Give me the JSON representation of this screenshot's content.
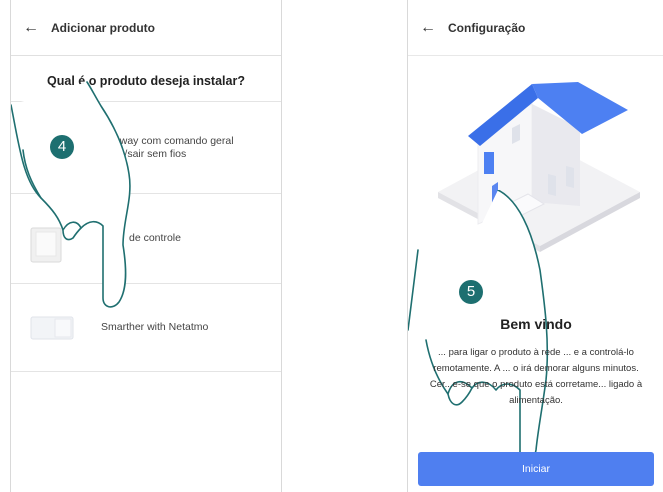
{
  "left_screen": {
    "title": "Adicionar produto",
    "back_icon": "arrow-left-icon",
    "question": "Qual é o produto deseja instalar?",
    "products": [
      {
        "label": "Gateway com comando geral entrar/sair sem fios",
        "icon": "gateway-icon"
      },
      {
        "label": "de controle",
        "icon": "control-device-icon"
      },
      {
        "label": "Smarther with Netatmo",
        "icon": "thermostat-icon"
      }
    ],
    "step_badge": "4"
  },
  "right_screen": {
    "title": "Configuração",
    "back_icon": "arrow-left-icon",
    "illustration": "house-illustration",
    "welcome_title": "Bem vindo",
    "welcome_text": "... para ligar o produto à rede ... e a controlá-lo remotamente. A ... o irá demorar alguns minutos. Cer...e-se que o produto está corretame... ligado à alimentação.",
    "start_button": "Iniciar",
    "step_badge": "5"
  },
  "colors": {
    "accent": "#4f7ff0",
    "badge": "#1d6f70",
    "hand_outline": "#1f6f70"
  }
}
